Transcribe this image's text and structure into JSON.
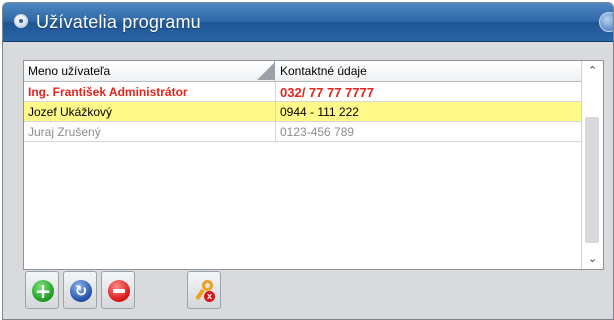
{
  "window": {
    "title": "Užívatelia programu",
    "icon": "app-icon",
    "accent": "#2e67a6"
  },
  "table": {
    "columns": [
      "Meno užívateľa",
      "Kontaktné údaje"
    ],
    "rows": [
      {
        "name": "Ing. František Administrátor",
        "contact": "032/ 77 77 7777",
        "state": "admin",
        "color": "#e3241b"
      },
      {
        "name": "Jozef Ukážkový",
        "contact": "0944 - 111 222",
        "state": "selected",
        "color": "#fff98a"
      },
      {
        "name": "Juraj Zrušený",
        "contact": "0123-456 789",
        "state": "disabled",
        "color": "#8a8d91"
      }
    ]
  },
  "toolbar": {
    "add_icon": "plus-icon",
    "refresh_icon": "refresh-icon",
    "remove_icon": "minus-icon",
    "key_icon": "key-icon"
  }
}
